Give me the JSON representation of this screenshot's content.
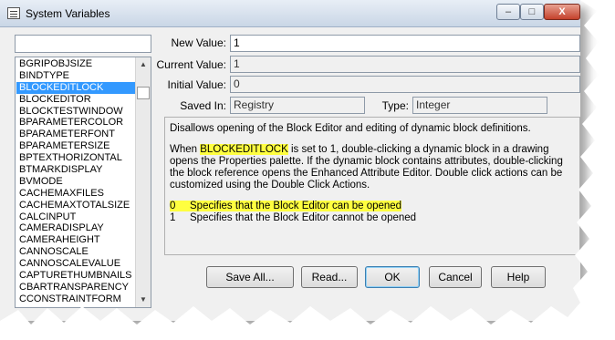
{
  "window": {
    "title": "System Variables"
  },
  "titlebar_buttons": {
    "minimize": "–",
    "maximize": "□",
    "close": "X"
  },
  "variable_list": {
    "items": [
      "BGRIPOBJSIZE",
      "BINDTYPE",
      "BLOCKEDITLOCK",
      "BLOCKEDITOR",
      "BLOCKTESTWINDOW",
      "BPARAMETERCOLOR",
      "BPARAMETERFONT",
      "BPARAMETERSIZE",
      "BPTEXTHORIZONTAL",
      "BTMARKDISPLAY",
      "BVMODE",
      "CACHEMAXFILES",
      "CACHEMAXTOTALSIZE",
      "CALCINPUT",
      "CAMERADISPLAY",
      "CAMERAHEIGHT",
      "CANNOSCALE",
      "CANNOSCALEVALUE",
      "CAPTURETHUMBNAILS",
      "CBARTRANSPARENCY",
      "CCONSTRAINTFORM"
    ],
    "selected_index": 2
  },
  "fields": {
    "new_value": {
      "label": "New Value:",
      "value": "1"
    },
    "current_value": {
      "label": "Current Value:",
      "value": "1"
    },
    "initial_value": {
      "label": "Initial Value:",
      "value": "0"
    },
    "saved_in": {
      "label": "Saved In:",
      "value": "Registry"
    },
    "type": {
      "label": "Type:",
      "value": "Integer"
    }
  },
  "description": {
    "summary": "Disallows opening of the Block Editor and editing of dynamic block definitions.",
    "para_prefix": "When ",
    "para_var": "BLOCKEDITLOCK",
    "para_rest": " is set to 1, double-clicking a dynamic block in a drawing opens the Properties palette. If the dynamic block contains attributes, double-clicking the block reference opens the Enhanced Attribute Editor. Double click actions can be customized using the Double Click Actions.",
    "options": [
      {
        "value": "0",
        "text": "Specifies that the Block Editor can be opened"
      },
      {
        "value": "1",
        "text": "Specifies that the Block Editor cannot be opened"
      }
    ]
  },
  "buttons": {
    "save_all": "Save All...",
    "read": "Read...",
    "ok": "OK",
    "cancel": "Cancel",
    "help": "Help"
  },
  "colors": {
    "highlight": "#ffff40",
    "selection": "#3399ff"
  }
}
